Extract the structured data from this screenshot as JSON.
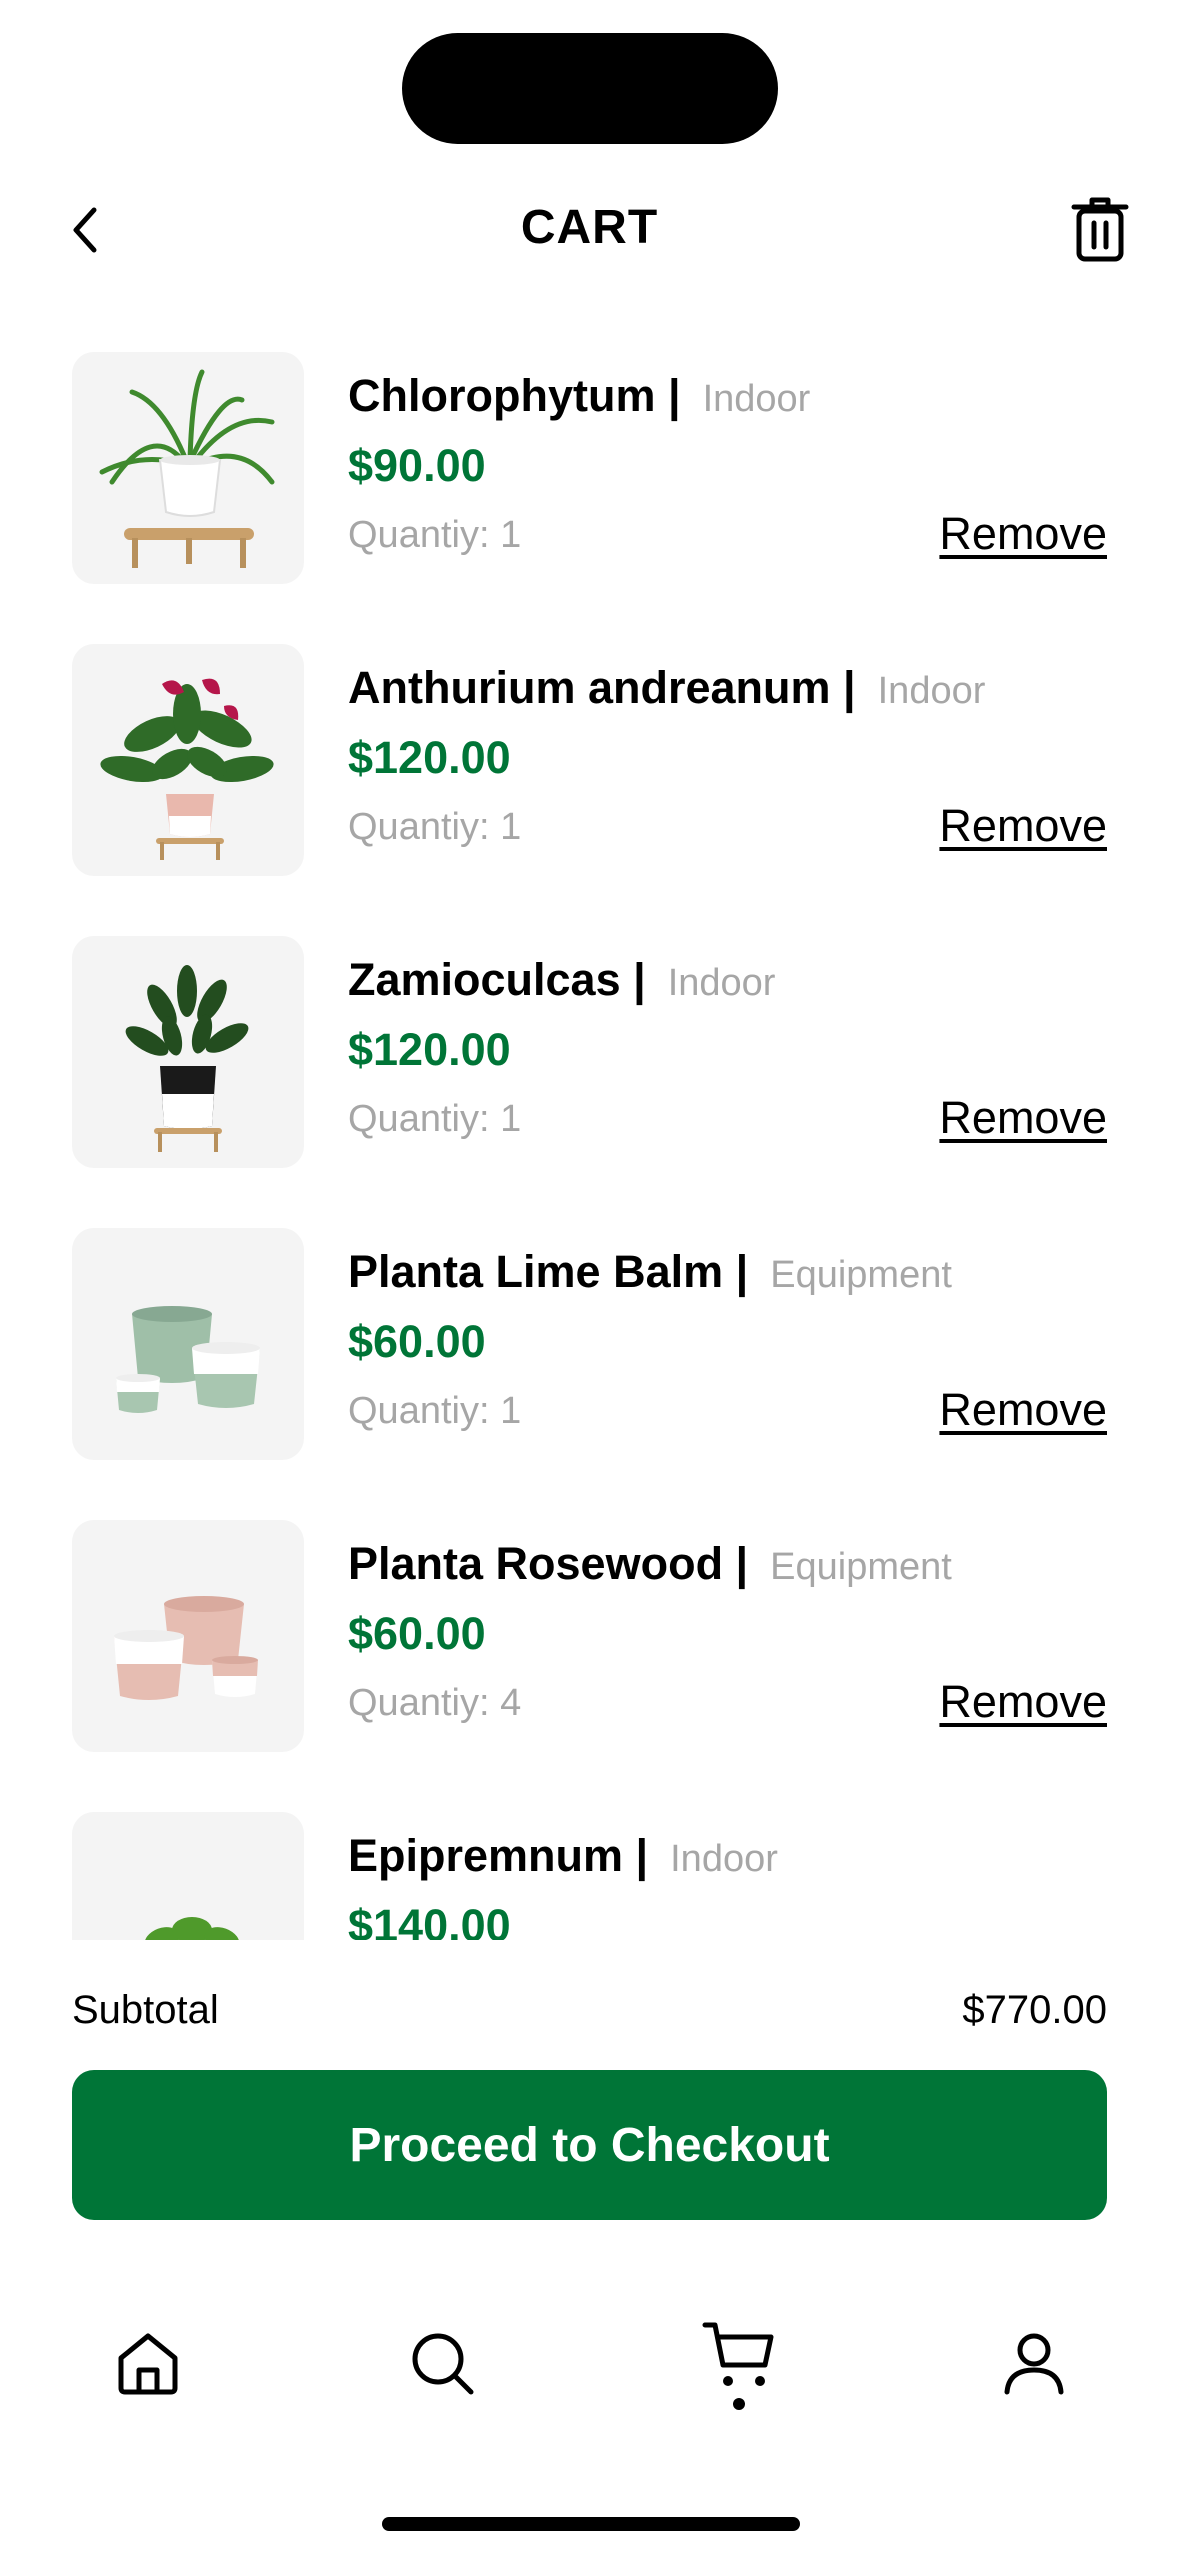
{
  "header": {
    "title": "CART",
    "back_icon": "chevron-left-icon",
    "trash_icon": "trash-icon"
  },
  "cart_items": [
    {
      "name": "Chlorophytum |",
      "category": "Indoor",
      "price": "$90.00",
      "quantity": "Quantiy: 1",
      "remove_label": "Remove",
      "image": "spider-plant-on-stand"
    },
    {
      "name": "Anthurium andreanum |",
      "category": "Indoor",
      "price": "$120.00",
      "quantity": "Quantiy: 1",
      "remove_label": "Remove",
      "image": "anthurium-red-flowers"
    },
    {
      "name": "Zamioculcas |",
      "category": "Indoor",
      "price": "$120.00",
      "quantity": "Quantiy: 1",
      "remove_label": "Remove",
      "image": "zz-plant-black-pot"
    },
    {
      "name": "Planta Lime Balm |",
      "category": "Equipment",
      "price": "$60.00",
      "quantity": "Quantiy: 1",
      "remove_label": "Remove",
      "image": "sage-green-pots"
    },
    {
      "name": "Planta Rosewood |",
      "category": "Equipment",
      "price": "$60.00",
      "quantity": "Quantiy: 4",
      "remove_label": "Remove",
      "image": "pink-pots"
    },
    {
      "name": "Epipremnum |",
      "category": "Indoor",
      "price": "$140.00",
      "quantity": "",
      "remove_label": "",
      "image": "pothos-plant"
    }
  ],
  "summary": {
    "subtotal_label": "Subtotal",
    "subtotal_value": "$770.00",
    "checkout_label": "Proceed to Checkout"
  },
  "tabbar": {
    "tabs": [
      {
        "icon": "home-icon",
        "active": false
      },
      {
        "icon": "search-icon",
        "active": false
      },
      {
        "icon": "cart-icon",
        "active": true
      },
      {
        "icon": "user-icon",
        "active": false
      }
    ]
  },
  "colors": {
    "accent": "#007537",
    "muted_text": "#a6a6a6",
    "thumb_bg": "#f4f4f4"
  }
}
